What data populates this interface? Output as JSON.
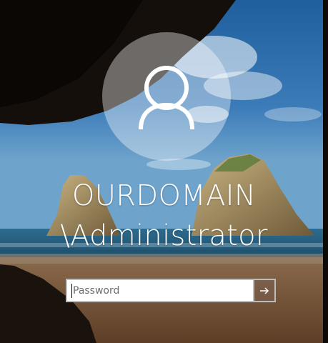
{
  "login": {
    "username_line1": "OURDOMAIN",
    "username_line2": "\\Administrator",
    "password_placeholder": "Password",
    "submit_icon": "arrow-right-icon",
    "avatar_icon": "user-icon"
  },
  "colors": {
    "sky": "#2d6aa6",
    "sea": "#2b5f86",
    "sand": "#7a5536",
    "cave": "#1a1410",
    "avatar_bg": "rgba(255,255,255,0.38)",
    "input_border": "#bcbcbc",
    "submit_bg": "rgba(120,95,80,0.55)"
  }
}
